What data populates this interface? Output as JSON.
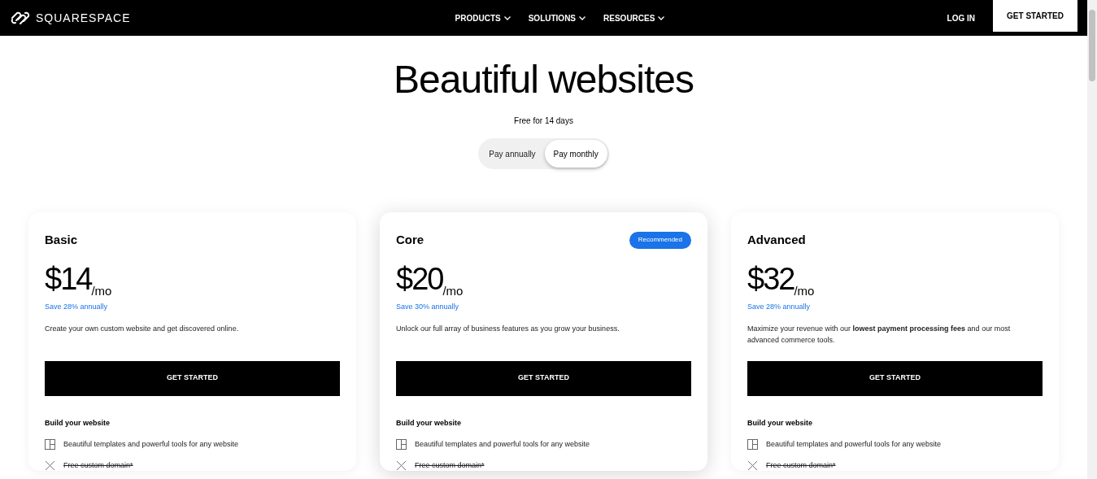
{
  "nav": {
    "logo": "SQUARESPACE",
    "menu": [
      {
        "label": "PRODUCTS"
      },
      {
        "label": "SOLUTIONS"
      },
      {
        "label": "RESOURCES"
      }
    ],
    "login": "LOG IN",
    "cta": "GET STARTED"
  },
  "hero": {
    "title": "Beautiful websites",
    "subtitle": "Free for 14 days"
  },
  "billing_toggle": [
    {
      "label": "Pay annually",
      "selected": false
    },
    {
      "label": "Pay monthly",
      "selected": true
    }
  ],
  "plans": [
    {
      "name": "Basic",
      "featured": false,
      "price": "$14",
      "period": "/mo",
      "savings": "Save 28% annually",
      "description": "Create your own custom website and get discovered online.",
      "button": "GET STARTED",
      "section": "Build your website",
      "features": [
        {
          "kind": "included",
          "text": "Beautiful templates and powerful tools for any website"
        },
        {
          "kind": "excluded",
          "text": "Free custom domain*"
        }
      ]
    },
    {
      "name": "Core",
      "badge": "Recommended",
      "featured": true,
      "price": "$20",
      "period": "/mo",
      "savings": "Save 30% annually",
      "description": "Unlock our full array of business features as you grow your business.",
      "button": "GET STARTED",
      "section": "Build your website",
      "features": [
        {
          "kind": "included",
          "text": "Beautiful templates and powerful tools for any website"
        },
        {
          "kind": "excluded",
          "text": "Free custom domain*"
        }
      ]
    },
    {
      "name": "Advanced",
      "featured": false,
      "price": "$32",
      "period": "/mo",
      "savings": "Save 28% annually",
      "description": "Maximize your revenue with our **lowest payment processing fees** and our most advanced commerce tools.",
      "button": "GET STARTED",
      "section": "Build your website",
      "features": [
        {
          "kind": "included",
          "text": "Beautiful templates and powerful tools for any website"
        },
        {
          "kind": "excluded",
          "text": "Free custom domain*"
        }
      ]
    }
  ]
}
